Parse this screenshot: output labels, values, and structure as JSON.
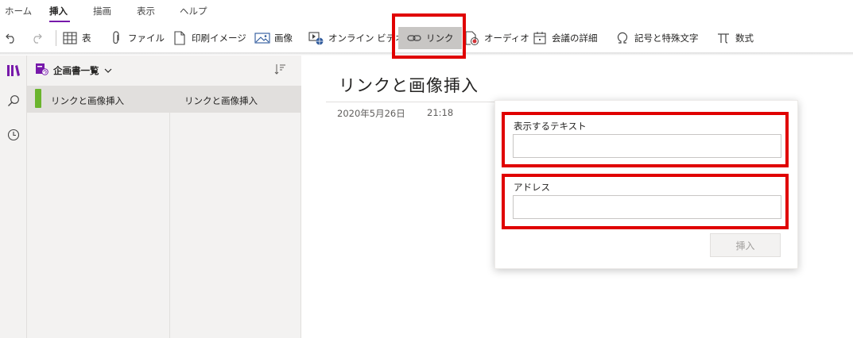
{
  "ribbon": {
    "tabs": [
      "ホーム",
      "挿入",
      "描画",
      "表示",
      "ヘルプ"
    ],
    "active_tab": "挿入",
    "accent_color": "#7719aa",
    "tools": {
      "table": "表",
      "file": "ファイル",
      "printout": "印刷イメージ",
      "picture": "画像",
      "online_video": "オンライン ビデオ",
      "link": "リンク",
      "audio": "オーディオ",
      "meeting_details": "会議の詳細",
      "symbol": "記号と特殊文字",
      "equation": "数式"
    }
  },
  "notebook": {
    "title": "企画書一覧",
    "sections": [
      {
        "label": "リンクと画像挿入",
        "color": "#6ab42d"
      }
    ],
    "pages": [
      {
        "label": "リンクと画像挿入"
      }
    ]
  },
  "page": {
    "title": "リンクと画像挿入",
    "date": "2020年5月26日",
    "time": "21:18"
  },
  "link_dialog": {
    "text_label": "表示するテキスト",
    "text_value": "",
    "address_label": "アドレス",
    "address_value": "",
    "insert_button": "挿入"
  },
  "highlight_color": "#e00000"
}
